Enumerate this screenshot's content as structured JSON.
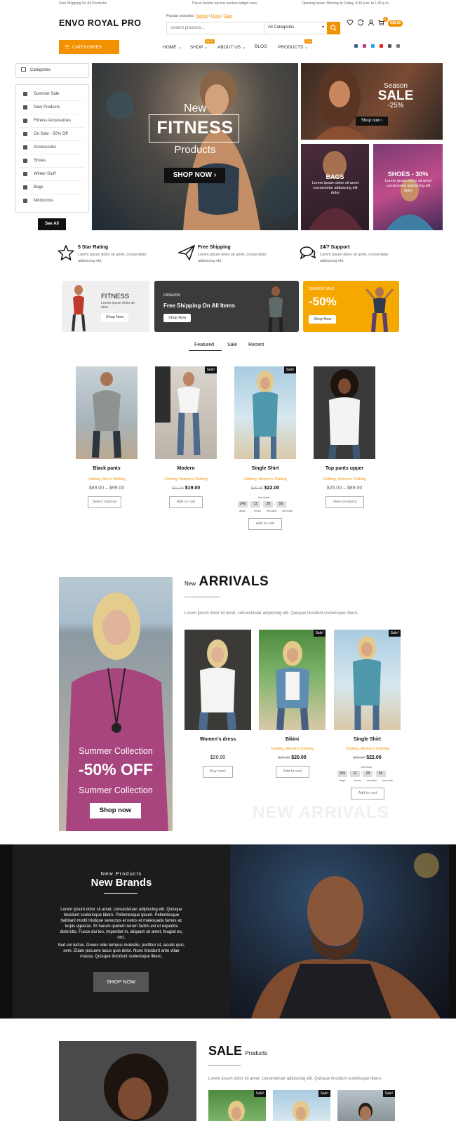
{
  "topbar": {
    "left": "Free Shipping On All Products!",
    "center": "This is header top bar section widget area.",
    "right": "Opening hours: Monday to Friday, 8:30 p.m. to 1:30 p.m."
  },
  "header": {
    "logo": "ENVO ROYAL PRO",
    "popular_label": "Popular searches:",
    "popular_links": [
      "Fashion",
      "Shoes",
      "Caps"
    ],
    "search_placeholder": "Search products...",
    "search_category": "All Categories",
    "cart_count": "1",
    "cart_total": "$19.00"
  },
  "nav": {
    "categories_button": "CATEGORIES",
    "items": [
      "HOME",
      "SHOP",
      "ABOUT US",
      "BLOG",
      "PRODUCTS"
    ],
    "badges": {
      "shop": "latest",
      "products": "new"
    }
  },
  "sidebar": {
    "title": "Categories",
    "items": [
      "Summer Sale",
      "New Products",
      "Fitness Accessories",
      "On Sale - 50% Off",
      "Accessories",
      "Shoes",
      "Winter Stuff",
      "Bags",
      "Motocross"
    ],
    "see_all": "See All"
  },
  "hero": {
    "line1": "New",
    "line2": "FITNESS",
    "line3": "Products",
    "button": "SHOP NOW"
  },
  "side_tiles": {
    "season_top": "Season",
    "season_sale": "SALE",
    "season_pct": "-25%",
    "season_button": "Shop now",
    "bags_title": "BAGS",
    "bags_text": "Lorem ipsum dolor sit amet consectetur adipiscing elit dolor",
    "shoes_title": "SHOES - 30%",
    "shoes_text": "Lorem ipsum dolor sit amet consectetur adipiscing elit dolor"
  },
  "features": [
    {
      "title": "5 Star Rating",
      "desc": "Lorem ipsum dolor sit amet, consectetur adipiscing elit."
    },
    {
      "title": "Free Shipping",
      "desc": "Lorem ipsum dolor sit amet, consectetur adipiscing elit."
    },
    {
      "title": "24/7 Support",
      "desc": "Lorem ipsum dolor sit amet, consectetur adipiscing elit."
    }
  ],
  "promos": {
    "p1_title": "FITNESS",
    "p1_desc": "Lorem ipsum dolor sit ame.",
    "p1_btn": "Shop Now",
    "p2_small": "FASHION",
    "p2_title": "Free Shipping On All Items",
    "p2_btn": "Shop Now",
    "p3_small": "SUMMER SALE",
    "p3_title": "-50%",
    "p3_btn": "Shop Now"
  },
  "tabs": [
    "Featured",
    "Sale",
    "Recent"
  ],
  "products": [
    {
      "title": "Black pants",
      "cats": "Clothing, Men's Clothing",
      "price_old": "",
      "price": "$89.00 – $99.00",
      "button": "Select options",
      "sale": ""
    },
    {
      "title": "Modern",
      "cats": "Clothing, Women's Clothing",
      "price_old": "$21.00",
      "price": "$19.00",
      "button": "Add to cart",
      "sale": "Sale!"
    },
    {
      "title": "Single Shirt",
      "cats": "Clothing, Women's Clothing",
      "price_old": "$30.00",
      "price": "$22.00",
      "button": "Add to cart",
      "sale": "Sale!"
    },
    {
      "title": "Top pants upper",
      "cats": "Clothing, Women's Clothing",
      "price_old": "",
      "price": "$25.00 – $89.00",
      "button": "View products",
      "sale": ""
    }
  ],
  "countdown": {
    "label": "Hot Deal",
    "values": [
      "349",
      "11",
      "28",
      "56"
    ],
    "units": [
      "days",
      "hours",
      "minutes",
      "seconds"
    ]
  },
  "arrivals": {
    "kicker": "New",
    "title": "ARRIVALS",
    "desc": "Lorem ipsum dolor sit amet, consectetuer adipiscing elit. Quisque tincidunt scelerisque libero.",
    "banner_top": "Summer Collection",
    "banner_big": "-50% OFF",
    "banner_bottom": "Summer Collection",
    "banner_btn": "Shop now",
    "watermark": "NEW ARRIVALS",
    "items": [
      {
        "title": "Women's dress",
        "cats": "",
        "price_old": "",
        "price": "$20.00",
        "button": "Buy now!",
        "sale": ""
      },
      {
        "title": "Bikini",
        "cats": "Clothing, Women's Clothing",
        "price_old": "$25.00",
        "price": "$20.00",
        "button": "Add to cart",
        "sale": "Sale!"
      },
      {
        "title": "Single Shirt",
        "cats": "Clothing, Women's Clothing",
        "price_old": "$30.00",
        "price": "$22.00",
        "button": "Add to cart",
        "sale": "Sale!"
      }
    ],
    "countdown_values": [
      "349",
      "11",
      "28",
      "56"
    ]
  },
  "brands": {
    "kicker": "New Products",
    "title": "New Brands",
    "p1": "Lorem ipsum dolor sit amet, consectetuer adipiscing elit. Quisque tincidunt scelerisque libero. Pellentesque ipsum. Pellentesque habitant morbi tristique senectus et netus et malesuada fames ac turpis egestas. Et harum quidem rerum facilis est et expedita distinctio. Fusce dui leo, imperdiet in, aliquam sit amet, feugiat eu, orci.",
    "p2": "Sed vel lectus. Donec odio tempus molestie, porttitor ut, iaculis quis, sem. Etiam posuere lacus quis dolor. Nunc tincidunt ante vitae massa. Quisque tincidunt scelerisque libero.",
    "button": "SHOP NOW"
  },
  "sale_section": {
    "title": "SALE",
    "kicker": "Products",
    "desc": "Lorem ipsum dolor sit amet, consectetuer adipiscing elit. Quisque tincidunt scelerisque libero.",
    "badge": "Sale!"
  },
  "colors": {
    "accent": "#f39200",
    "dark": "#1c1c1c"
  }
}
